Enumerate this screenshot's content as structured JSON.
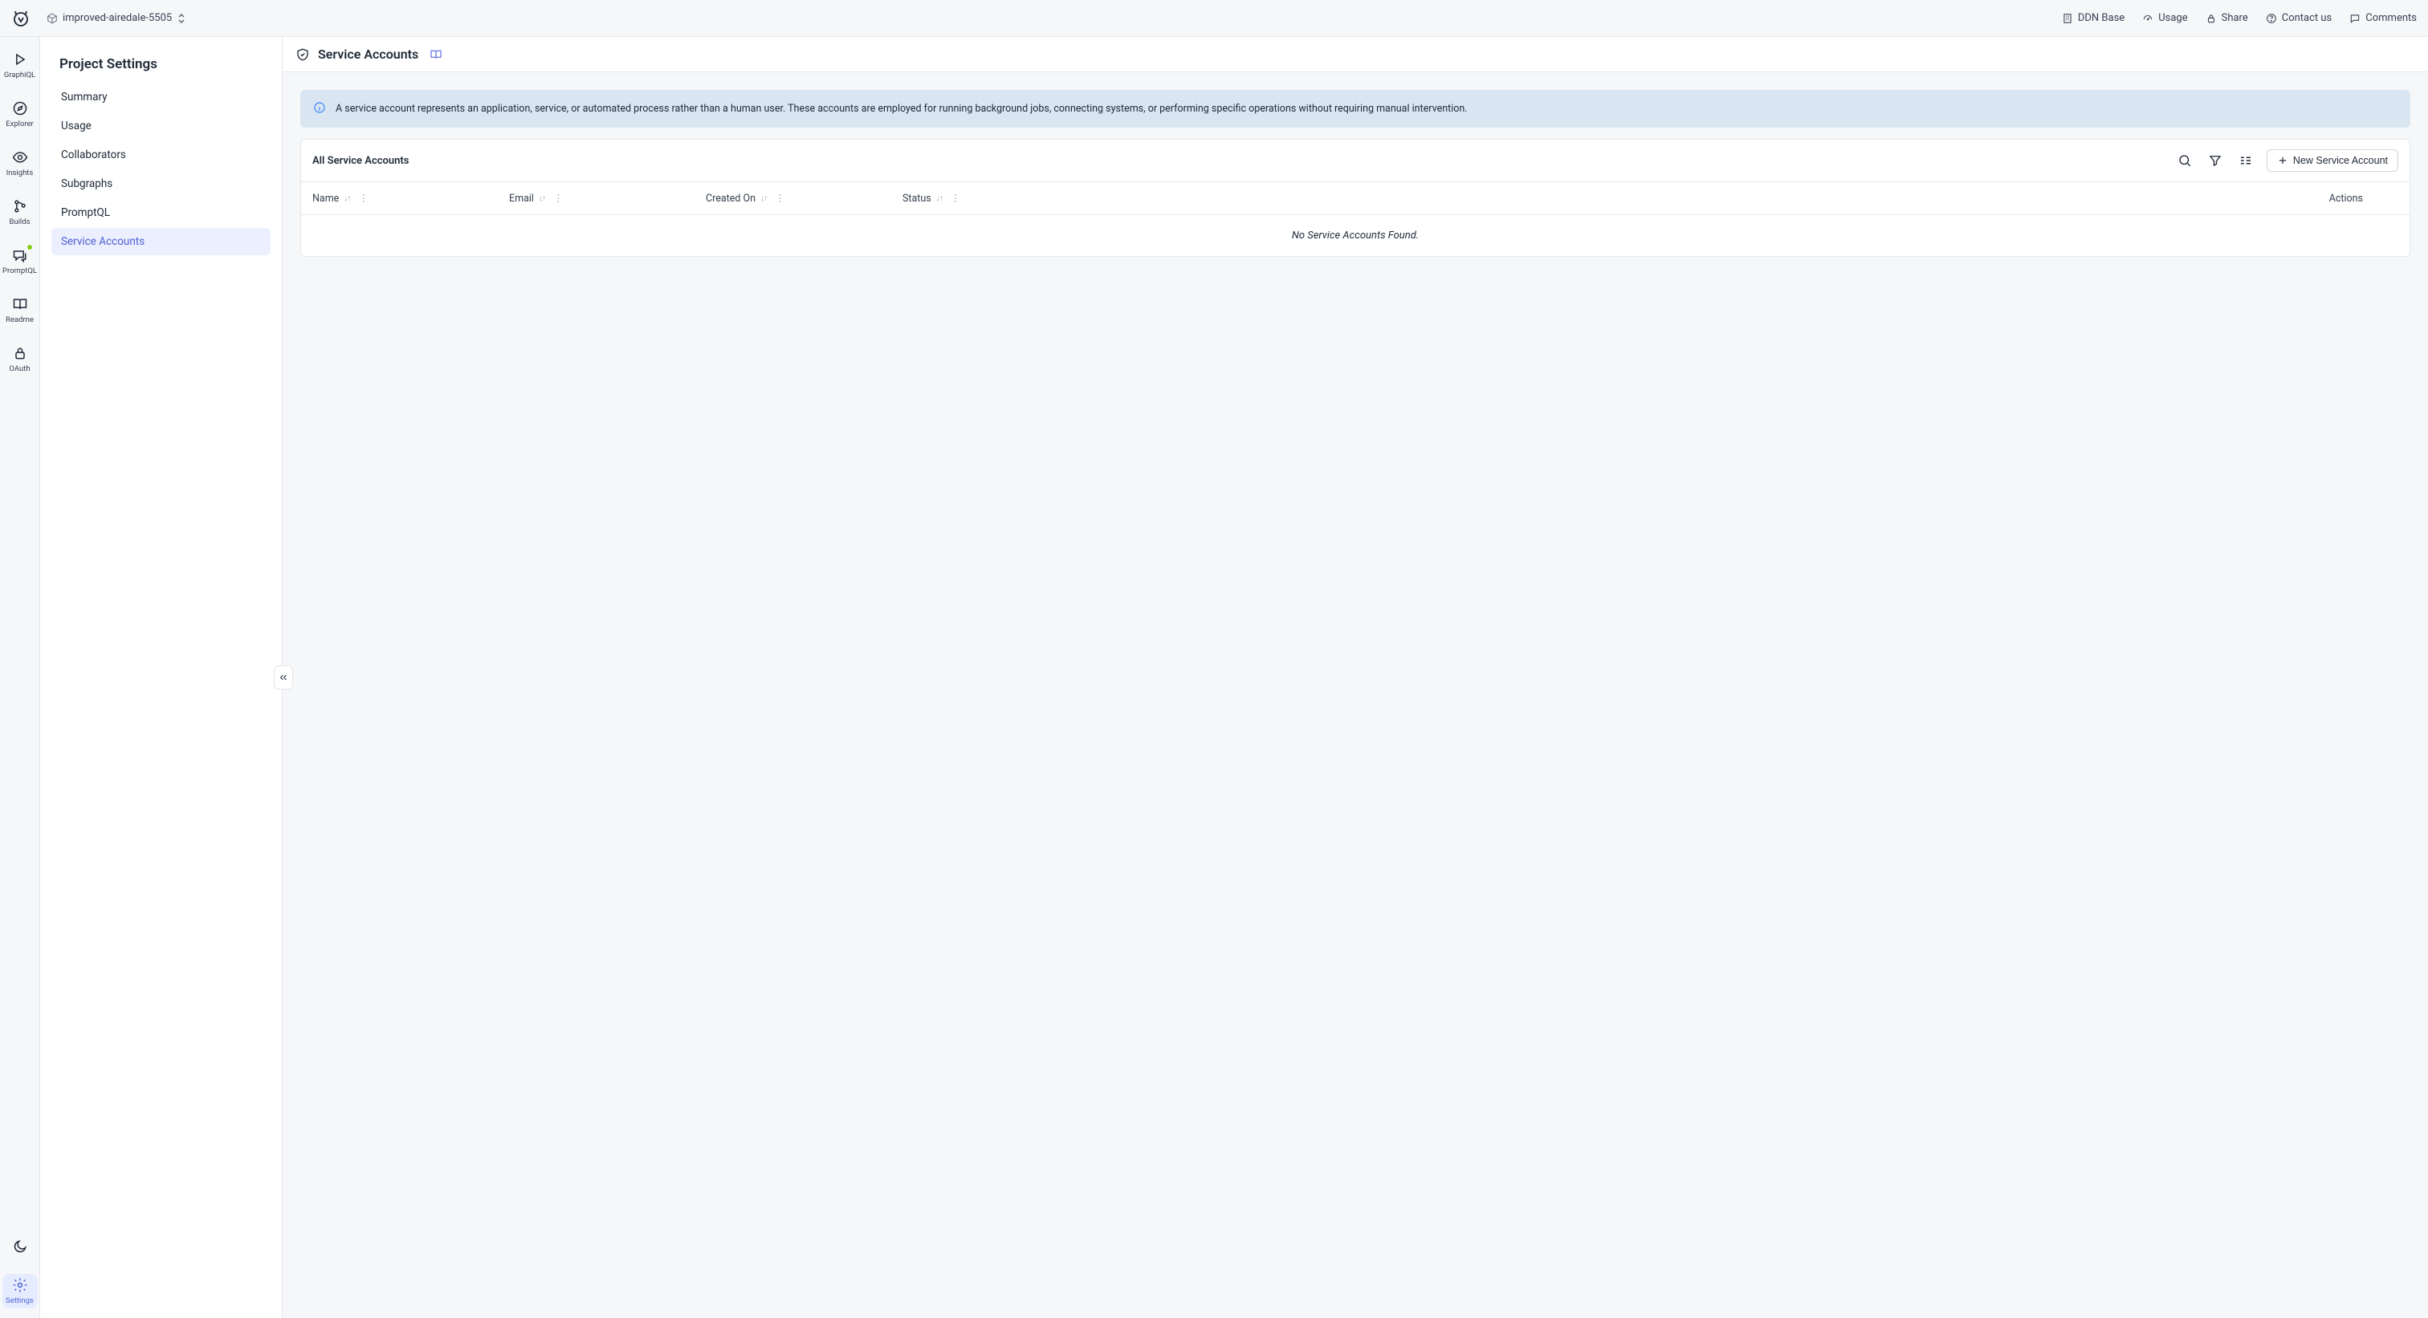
{
  "project_name": "improved-airedale-5505",
  "top_links": [
    {
      "key": "ddn",
      "label": "DDN Base"
    },
    {
      "key": "usage",
      "label": "Usage"
    },
    {
      "key": "share",
      "label": "Share"
    },
    {
      "key": "contact",
      "label": "Contact us"
    },
    {
      "key": "comments",
      "label": "Comments"
    }
  ],
  "iconbar": {
    "items": [
      {
        "key": "graphiql",
        "label": "GraphiQL"
      },
      {
        "key": "explorer",
        "label": "Explorer"
      },
      {
        "key": "insights",
        "label": "Insights"
      },
      {
        "key": "builds",
        "label": "Builds"
      },
      {
        "key": "promptql",
        "label": "PromptQL",
        "badge": true
      },
      {
        "key": "readme",
        "label": "Readme"
      },
      {
        "key": "oauth",
        "label": "OAuth"
      }
    ],
    "settings_label": "Settings"
  },
  "settings": {
    "title": "Project Settings",
    "items": [
      {
        "key": "summary",
        "label": "Summary"
      },
      {
        "key": "usage",
        "label": "Usage"
      },
      {
        "key": "collaborators",
        "label": "Collaborators"
      },
      {
        "key": "subgraphs",
        "label": "Subgraphs"
      },
      {
        "key": "promptql",
        "label": "PromptQL"
      },
      {
        "key": "service",
        "label": "Service Accounts",
        "active": true
      }
    ]
  },
  "page": {
    "title": "Service Accounts",
    "info": "A service account represents an application, service, or automated process rather than a human user. These accounts are employed for running background jobs, connecting systems, or performing specific operations without requiring manual intervention.",
    "table_title": "All Service Accounts",
    "new_button": "New Service Account",
    "columns": {
      "name": "Name",
      "email": "Email",
      "created": "Created On",
      "status": "Status",
      "actions": "Actions"
    },
    "empty": "No Service Accounts Found."
  }
}
